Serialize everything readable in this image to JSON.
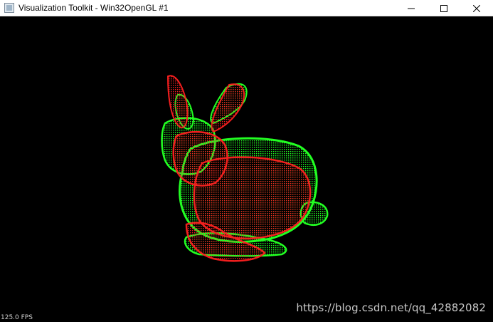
{
  "window": {
    "title": "Visualization Toolkit - Win32OpenGL #1",
    "controls": {
      "minimize_icon": "minimize-icon",
      "maximize_icon": "maximize-icon",
      "close_icon": "close-icon"
    }
  },
  "viewport": {
    "background": "#000000",
    "render": {
      "models": [
        {
          "name": "bunny-point-cloud-red",
          "color": "#ff2020"
        },
        {
          "name": "bunny-point-cloud-green",
          "color": "#22ff22"
        }
      ]
    },
    "fps_text": "125.0 FPS",
    "watermark": "https://blog.csdn.net/qq_42882082"
  }
}
